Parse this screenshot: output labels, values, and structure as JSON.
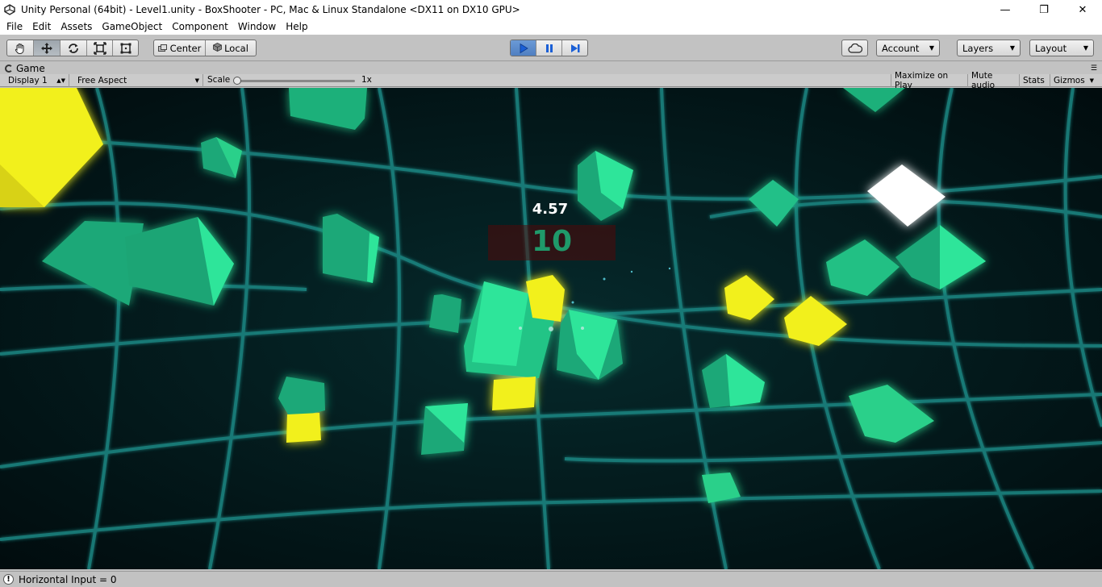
{
  "window": {
    "title": "Unity Personal (64bit) - Level1.unity - BoxShooter - PC, Mac & Linux Standalone <DX11 on DX10 GPU>",
    "minimize": "—",
    "maximize": "❐",
    "close": "✕"
  },
  "menu": [
    "File",
    "Edit",
    "Assets",
    "GameObject",
    "Component",
    "Window",
    "Help"
  ],
  "toolbar": {
    "tools": [
      "hand-tool-icon",
      "move-tool-icon",
      "rotate-tool-icon",
      "scale-tool-icon",
      "rect-tool-icon"
    ],
    "active_tool": "move-tool-icon",
    "pivot_label": "Center",
    "space_label": "Local",
    "play_state": "playing",
    "account_label": "Account",
    "layers_label": "Layers",
    "layout_label": "Layout"
  },
  "game_view": {
    "tab_label": "Game",
    "display_label": "Display 1",
    "aspect_label": "Free Aspect",
    "scale_label": "Scale",
    "scale_value": "1x",
    "maximize_label": "Maximize on Play",
    "mute_label": "Mute audio",
    "stats_label": "Stats",
    "gizmos_label": "Gizmos"
  },
  "hud": {
    "time": "4.57",
    "score": "10"
  },
  "colors": {
    "grid": "#1f8a86",
    "green_cube": "#22d98a",
    "yellow_cube": "#f2f01e",
    "white_cube": "#ffffff",
    "background": "#021418"
  },
  "status": {
    "message": "Horizontal Input = 0"
  }
}
